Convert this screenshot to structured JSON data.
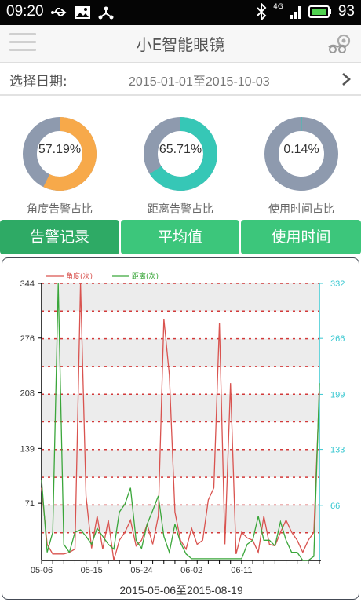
{
  "status": {
    "time": "09:20",
    "battery": "93",
    "network": "4G"
  },
  "header": {
    "title": "小E智能眼镜"
  },
  "date_row": {
    "label": "选择日期:",
    "range": "2015-01-01至2015-10-03"
  },
  "stats": [
    {
      "value_text": "57.19%",
      "caption": "角度告警占比",
      "fraction": 0.5719,
      "color": "#f7a94a",
      "track": "#8e9aae"
    },
    {
      "value_text": "65.71%",
      "caption": "距离告警占比",
      "fraction": 0.6571,
      "color": "#36c7b6",
      "track": "#8e9aae"
    },
    {
      "value_text": "0.14%",
      "caption": "使用时间占比",
      "fraction": 0.0014,
      "color": "#36c7b6",
      "track": "#8e9aae"
    }
  ],
  "tabs": [
    {
      "label": "告警记录",
      "active": true
    },
    {
      "label": "平均值",
      "active": false
    },
    {
      "label": "使用时间",
      "active": false
    }
  ],
  "colors": {
    "accent": "#3cc67b",
    "angle_series": "#d9534f",
    "distance_series": "#3aa63a",
    "right_axis": "#36c7d0"
  },
  "chart_data": {
    "type": "line",
    "legend_position": "top-left",
    "grid": true,
    "left_axis": {
      "ticks": [
        "344",
        "276",
        "208",
        "139",
        "71"
      ],
      "ylim": [
        0,
        344
      ]
    },
    "right_axis": {
      "ticks": [
        "332",
        "266",
        "199",
        "133",
        "66"
      ],
      "ylim": [
        0,
        332
      ]
    },
    "x_ticks": [
      "05-06",
      "05-15",
      "05-24",
      "06-02",
      "06-11"
    ],
    "xlabel": "2015-05-06至2015-08-19",
    "series": [
      {
        "name": "角度(次)",
        "axis": "left",
        "values": [
          90,
          20,
          8,
          8,
          8,
          10,
          14,
          344,
          80,
          15,
          55,
          14,
          50,
          0,
          25,
          35,
          50,
          18,
          25,
          45,
          20,
          55,
          300,
          230,
          60,
          25,
          14,
          40,
          20,
          25,
          75,
          90,
          295,
          20,
          220,
          8,
          35,
          28,
          25,
          10,
          55,
          20,
          18,
          35,
          50,
          35,
          25,
          10,
          25,
          35,
          210
        ]
      },
      {
        "name": "距离(次)",
        "axis": "left",
        "values": [
          100,
          10,
          35,
          344,
          20,
          10,
          35,
          38,
          30,
          20,
          40,
          30,
          20,
          14,
          60,
          70,
          90,
          25,
          15,
          45,
          62,
          80,
          30,
          10,
          45,
          22,
          8,
          2,
          2,
          2,
          2,
          2,
          2,
          2,
          2,
          2,
          2,
          20,
          25,
          55,
          25,
          25,
          18,
          48,
          25,
          10,
          10,
          0,
          0,
          5,
          220
        ]
      }
    ]
  }
}
